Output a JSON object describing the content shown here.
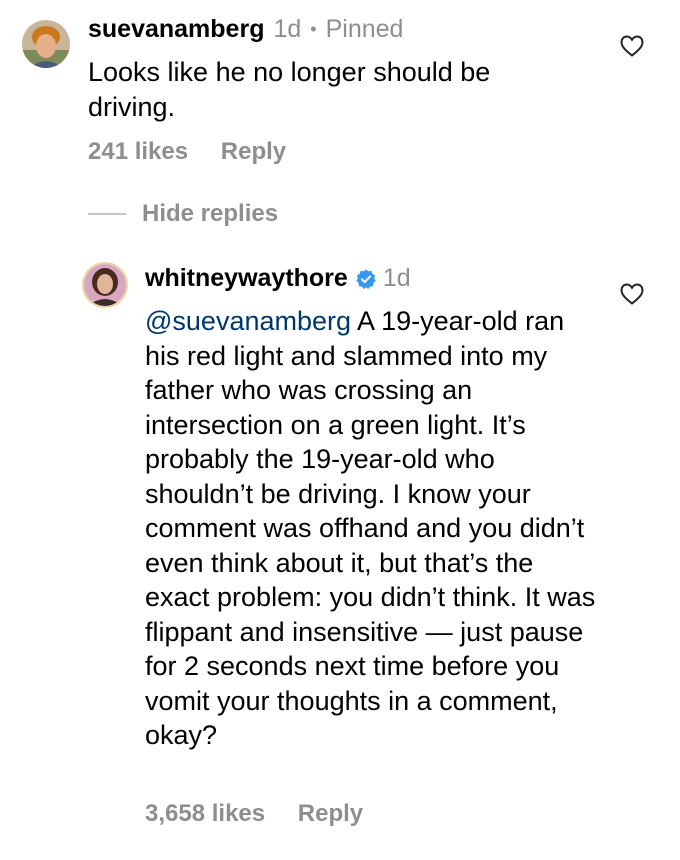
{
  "comment": {
    "username": "suevanamberg",
    "time": "1d",
    "separator": "•",
    "pinned": "Pinned",
    "text": "Looks like he no longer should be driving.",
    "likes": "241 likes",
    "reply_label": "Reply",
    "heart_icon": "heart-outline-icon"
  },
  "hide_replies_label": "Hide replies",
  "reply": {
    "username": "whitneywaythore",
    "verified_icon": "verified-badge-icon",
    "time": "1d",
    "mention": "@suevanamberg",
    "text": " A 19-year-old ran his red light and slammed into my father who was crossing an intersection on a green light. It’s probably the 19-year-old who shouldn’t be driving. I know your comment was offhand and you didn’t even think about it, but that’s the exact problem: you didn’t think. It was flippant and insensitive — just pause for 2 seconds next time before you vomit your thoughts in a comment, okay?",
    "likes": "3,658 likes",
    "reply_label": "Reply",
    "heart_icon": "heart-outline-icon"
  },
  "colors": {
    "muted": "#8e8e8e",
    "mention": "#00376b",
    "verified": "#3897f0",
    "divider": "#c7c7c7"
  }
}
